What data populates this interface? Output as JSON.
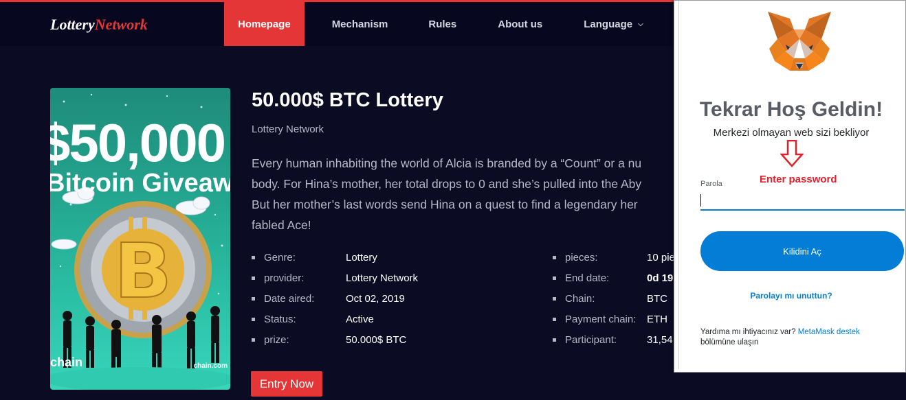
{
  "header": {
    "logo_part1": "Lottery",
    "logo_part2": "Network",
    "nav": [
      {
        "label": "Homepage",
        "active": true
      },
      {
        "label": "Mechanism"
      },
      {
        "label": "Rules"
      },
      {
        "label": "About us"
      },
      {
        "label": "Language"
      }
    ]
  },
  "poster": {
    "amount": "$50,000",
    "giveaway": "Bitcoin Giveaway",
    "brand_left": "chain",
    "brand_right": "chain.com"
  },
  "lottery": {
    "title": "50.000$ BTC Lottery",
    "subtitle": "Lottery Network",
    "description_lines": [
      "Every human inhabiting the world of Alcia is branded by a “Count” or a nu",
      "body. For Hina’s mother, her total drops to 0 and she’s pulled into the Aby",
      "But her mother’s last words send Hina on a quest to find a legendary her",
      "fabled Ace!"
    ],
    "info_left": [
      {
        "key": "Genre:",
        "value": "Lottery"
      },
      {
        "key": "provider:",
        "value": "Lottery Network"
      },
      {
        "key": "Date aired:",
        "value": "Oct 02, 2019"
      },
      {
        "key": "Status:",
        "value": "Active"
      },
      {
        "key": "prize:",
        "value": "50.000$ BTC"
      }
    ],
    "info_right": [
      {
        "key": "pieces:",
        "value": "10 pie"
      },
      {
        "key": "End date:",
        "value": "0d 19"
      },
      {
        "key": "Chain:",
        "value": "BTC"
      },
      {
        "key": "Payment chain:",
        "value": "ETH"
      },
      {
        "key": "Participant:",
        "value": "31,54"
      }
    ],
    "entry_button": "Entry Now"
  },
  "metamask": {
    "title": "Tekrar Hoş Geldin!",
    "subtitle": "Merkezi olmayan web sizi bekliyor",
    "annotation": "Enter password",
    "password_label": "Parola",
    "password_value": "",
    "unlock_button": "Kilidini Aç",
    "forgot_link": "Parolayı mı unuttun?",
    "help_text": "Yardıma mı ihtiyacınız var?",
    "help_link": "MetaMask destek",
    "help_text2": "bölümüne ulaşın",
    "colors": {
      "accent": "#037dd6",
      "annotation": "#e0202a",
      "title": "#585c64"
    }
  },
  "theme": {
    "accent": "#e53637",
    "background": "#0b0c24"
  }
}
